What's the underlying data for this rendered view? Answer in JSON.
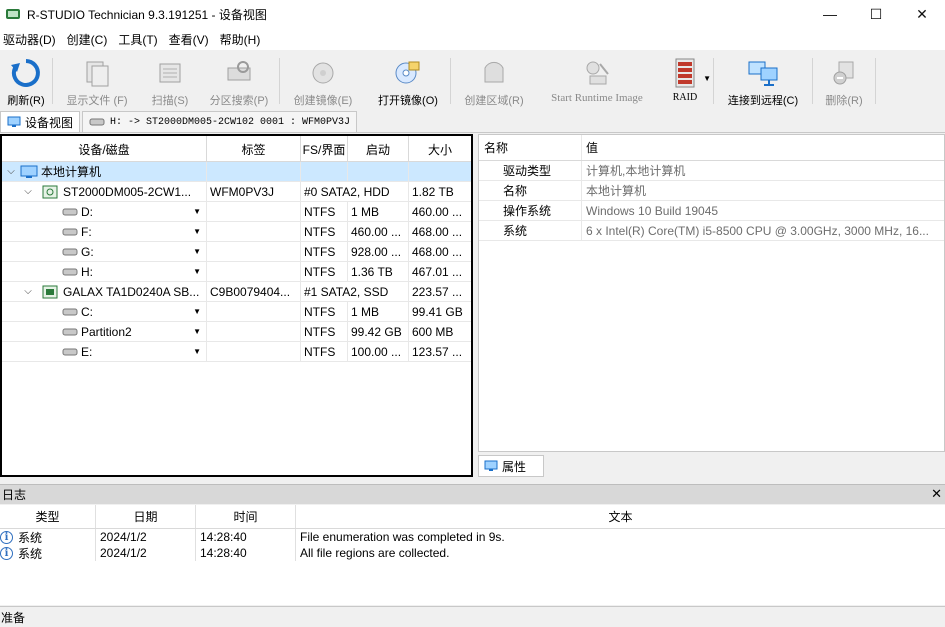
{
  "window": {
    "title": "R-STUDIO Technician 9.3.191251 - 设备视图",
    "minimize": "—",
    "maximize": "☐",
    "close": "✕"
  },
  "menu": [
    "驱动器(D)",
    "创建(C)",
    "工具(T)",
    "查看(V)",
    "帮助(H)"
  ],
  "toolbar": {
    "refresh": "刷新(R)",
    "show_files": "显示文件 (F)",
    "scan": "扫描(S)",
    "partition_search": "分区搜索(P)",
    "create_image": "创建镜像(E)",
    "open_image": "打开镜像(O)",
    "create_region": "创建区域(R)",
    "start_runtime": "Start Runtime Image",
    "raid": "RAID",
    "connect_remote": "连接到远程(C)",
    "delete": "删除(R)"
  },
  "tabs": {
    "device_view": "设备视图",
    "drive_tab": "H: -> ST2000DM005-2CW102 0001 : WFM0PV3J"
  },
  "device_grid": {
    "headers": [
      "设备/磁盘",
      "标签",
      "FS/界面",
      "启动",
      "大小"
    ],
    "rows": [
      {
        "name": "本地计算机",
        "label": "",
        "fs": "",
        "start": "",
        "size": ""
      },
      {
        "name": "ST2000DM005-2CW1...",
        "label": "WFM0PV3J",
        "fs": "#0 SATA2, HDD",
        "start": "",
        "size": "1.82 TB"
      },
      {
        "name": "D:",
        "label": "",
        "fs": "NTFS",
        "start": "1 MB",
        "size": "460.00 ..."
      },
      {
        "name": "F:",
        "label": "",
        "fs": "NTFS",
        "start": "460.00 ...",
        "size": "468.00 ..."
      },
      {
        "name": "G:",
        "label": "",
        "fs": "NTFS",
        "start": "928.00 ...",
        "size": "468.00 ..."
      },
      {
        "name": "H:",
        "label": "",
        "fs": "NTFS",
        "start": "1.36 TB",
        "size": "467.01 ..."
      },
      {
        "name": "GALAX TA1D0240A SB...",
        "label": "C9B0079404...",
        "fs": "#1 SATA2, SSD",
        "start": "",
        "size": "223.57 ..."
      },
      {
        "name": "C:",
        "label": "",
        "fs": "NTFS",
        "start": "1 MB",
        "size": "99.41 GB"
      },
      {
        "name": "Partition2",
        "label": "",
        "fs": "NTFS",
        "start": "99.42 GB",
        "size": "600 MB"
      },
      {
        "name": "E:",
        "label": "",
        "fs": "NTFS",
        "start": "100.00 ...",
        "size": "123.57 ..."
      }
    ]
  },
  "properties": {
    "headers": [
      "名称",
      "值"
    ],
    "rows": [
      {
        "name": "驱动类型",
        "value": "计算机,本地计算机"
      },
      {
        "name": "名称",
        "value": "本地计算机"
      },
      {
        "name": "操作系统",
        "value": "Windows 10 Build 19045"
      },
      {
        "name": "系统",
        "value": "6 x Intel(R) Core(TM) i5-8500 CPU @ 3.00GHz, 3000 MHz, 16..."
      }
    ],
    "tab": "属性"
  },
  "log": {
    "title": "日志",
    "close": "✕",
    "headers": [
      "类型",
      "日期",
      "时间",
      "文本"
    ],
    "rows": [
      {
        "type": "系统",
        "date": "2024/1/2",
        "time": "14:28:40",
        "text": "File enumeration was completed in 9s."
      },
      {
        "type": "系统",
        "date": "2024/1/2",
        "time": "14:28:40",
        "text": "All file regions are collected."
      }
    ]
  },
  "status": "准备",
  "colors": {
    "selection": "#cce8ff",
    "accent_blue": "#1a6fc9",
    "panel_border": "#000000"
  }
}
